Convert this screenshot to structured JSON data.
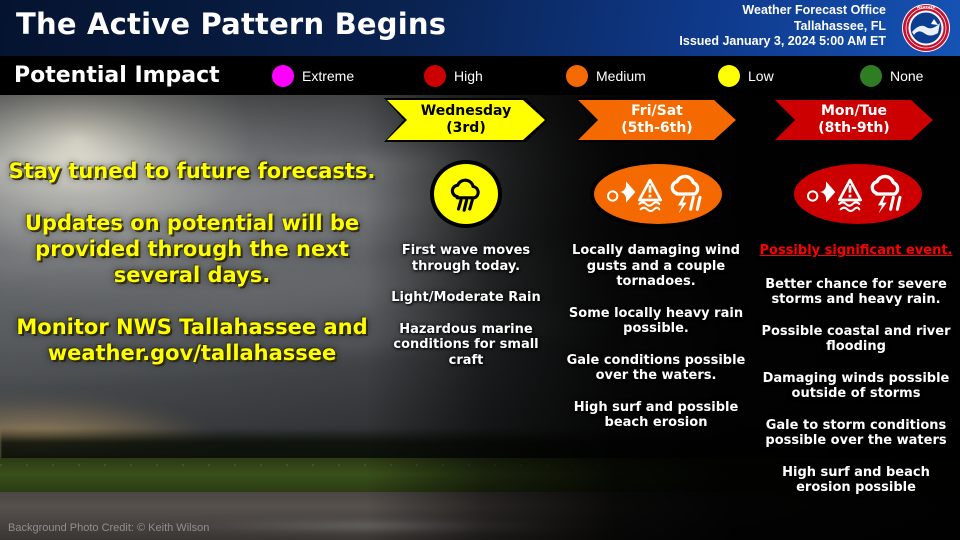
{
  "header": {
    "title": "The Active Pattern Begins",
    "office_line1": "Weather Forecast Office",
    "office_line2": "Tallahassee, FL",
    "office_line3": "Issued January 3, 2024 5:00 AM ET",
    "logo_icon": "nws-logo-icon",
    "bg_gradient_from": "#05132f",
    "bg_gradient_to": "#1553b4"
  },
  "legend": {
    "title": "Potential Impact",
    "items": [
      {
        "label": "Extreme",
        "color": "#ff00ff",
        "icon": "circle-icon"
      },
      {
        "label": "High",
        "color": "#cc0000",
        "icon": "circle-icon"
      },
      {
        "label": "Medium",
        "color": "#f56a00",
        "icon": "circle-icon"
      },
      {
        "label": "Low",
        "color": "#ffff00",
        "icon": "circle-icon"
      },
      {
        "label": "None",
        "color": "#2e7d22",
        "icon": "circle-icon"
      }
    ]
  },
  "left_panel": {
    "lines": [
      "Stay tuned to future forecasts.",
      "Updates on potential will be provided through the next several days.",
      "Monitor NWS Tallahassee and weather.gov/tallahassee"
    ],
    "text_color": "#ffff00"
  },
  "columns": [
    {
      "banner_label_line1": "Wednesday",
      "banner_label_line2": "(3rd)",
      "banner_color": "#ffff00",
      "banner_text_color": "#000000",
      "impact_level": "Low",
      "icon_shape": "circle",
      "icon_color": "#ffff00",
      "icon_glyph_color": "#000000",
      "icons": [
        "rain-cloud-icon"
      ],
      "bullets": [
        "First wave moves through today.",
        "Light/Moderate Rain",
        "Hazardous marine conditions for small craft"
      ],
      "alert": null
    },
    {
      "banner_label_line1": "Fri/Sat",
      "banner_label_line2": "(5th-6th)",
      "banner_color": "#f56a00",
      "banner_text_color": "#ffffff",
      "impact_level": "Medium",
      "icon_shape": "ellipse",
      "icon_color": "#f56a00",
      "icon_glyph_color": "#ffffff",
      "icons": [
        "wind-icon",
        "coastal-flood-icon",
        "thunderstorm-icon"
      ],
      "bullets": [
        "Locally damaging wind gusts and a couple tornadoes.",
        "Some locally heavy rain possible.",
        "Gale conditions possible over the waters.",
        "High surf and possible beach erosion"
      ],
      "alert": null
    },
    {
      "banner_label_line1": "Mon/Tue",
      "banner_label_line2": "(8th-9th)",
      "banner_color": "#cc0000",
      "banner_text_color": "#ffffff",
      "impact_level": "High",
      "icon_shape": "ellipse",
      "icon_color": "#cc0000",
      "icon_glyph_color": "#ffffff",
      "icons": [
        "wind-icon",
        "coastal-flood-icon",
        "thunderstorm-icon"
      ],
      "alert": "Possibly significant event.",
      "alert_color": "#ff0000",
      "bullets": [
        "Better chance for severe storms and heavy rain.",
        "Possible coastal and river flooding",
        "Damaging winds possible outside of storms",
        "Gale to storm conditions possible over the waters",
        "High surf and beach erosion possible"
      ]
    }
  ],
  "footer": {
    "photo_credit": "Background Photo Credit: © Keith Wilson"
  }
}
